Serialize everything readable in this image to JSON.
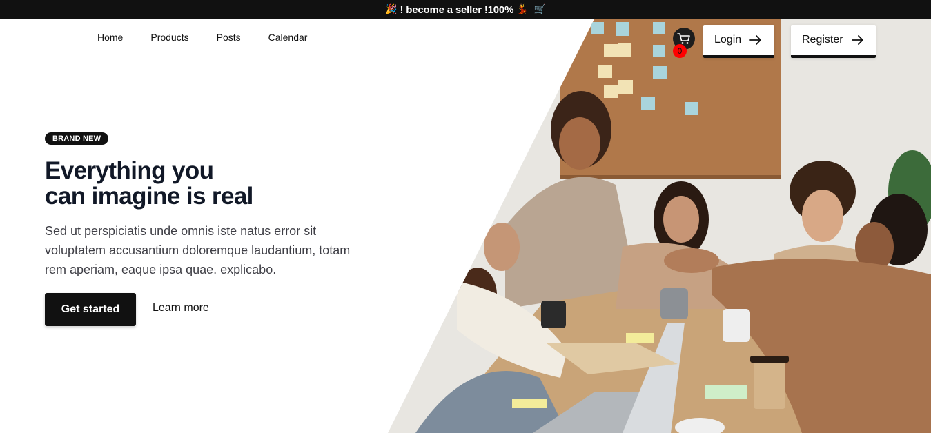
{
  "announcement": {
    "emoji_left": "🎉",
    "text": "! become a seller !100%",
    "emoji_dancer": "💃",
    "emoji_cart": "🛒"
  },
  "nav": {
    "items": [
      "Home",
      "Products",
      "Posts",
      "Calendar"
    ]
  },
  "header": {
    "cart_icon": "cart-icon",
    "cart_count": "0",
    "login_label": "Login",
    "register_label": "Register"
  },
  "hero": {
    "badge": "BRAND NEW",
    "title_line1": "Everything you",
    "title_line2": "can imagine is real",
    "description": "Sed ut perspiciatis unde omnis iste natus error sit voluptatem accusantium doloremque laudantium, totam rem aperiam, eaque ipsa quae. explicabo.",
    "primary_cta": "Get started",
    "secondary_cta": "Learn more"
  },
  "colors": {
    "topbar_bg": "#111111",
    "primary": "#111111",
    "cart_badge": "#ff0000"
  }
}
